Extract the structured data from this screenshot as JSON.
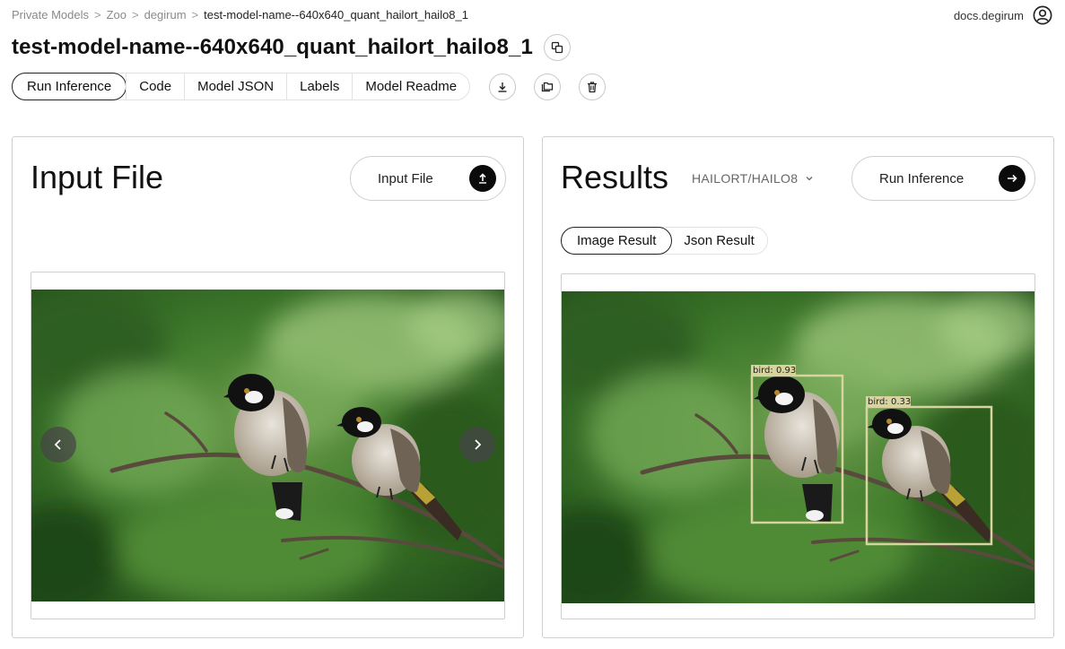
{
  "breadcrumb": {
    "items": [
      "Private Models",
      "Zoo",
      "degirum"
    ],
    "current": "test-model-name--640x640_quant_hailort_hailo8_1",
    "separator": ">"
  },
  "header": {
    "docs_link": "docs.degirum",
    "title": "test-model-name--640x640_quant_hailort_hailo8_1"
  },
  "tabs": [
    {
      "label": "Run Inference",
      "active": true
    },
    {
      "label": "Code",
      "active": false
    },
    {
      "label": "Model JSON",
      "active": false
    },
    {
      "label": "Labels",
      "active": false
    },
    {
      "label": "Model Readme",
      "active": false
    }
  ],
  "input_panel": {
    "heading": "Input File",
    "upload_button_label": "Input File"
  },
  "results_panel": {
    "heading": "Results",
    "runtime_select": "HAILORT/HAILO8",
    "run_button_label": "Run Inference",
    "result_tabs": [
      {
        "label": "Image Result",
        "active": true
      },
      {
        "label": "Json Result",
        "active": false
      }
    ],
    "detections": [
      {
        "label": "bird: 0.93"
      },
      {
        "label": "bird: 0.33"
      }
    ]
  },
  "colors": {
    "accent": "#0b0b0b",
    "border": "#cfcfcf",
    "detection_box": "#d8d4a0"
  },
  "icons": [
    "copy-icon",
    "download-icon",
    "folder-icon",
    "trash-icon",
    "upload-icon",
    "arrow-right-icon",
    "user-icon",
    "chevron-down-icon",
    "chevron-left-icon",
    "chevron-right-icon"
  ]
}
